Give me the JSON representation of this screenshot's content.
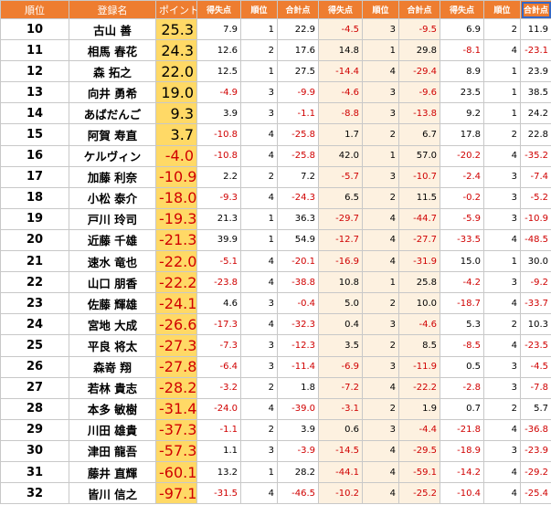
{
  "columns": [
    "順位",
    "登録名",
    "ポイント",
    "得失点",
    "順位",
    "合計点",
    "得失点",
    "順位",
    "合計点",
    "得失点",
    "順位",
    "合計点"
  ],
  "rows": [
    {
      "rank": "10",
      "name": "古山 善",
      "points": "25.3",
      "c": [
        "7.9",
        "1",
        "22.9",
        "-4.5",
        "3",
        "-9.5",
        "6.9",
        "2",
        "11.9"
      ]
    },
    {
      "rank": "11",
      "name": "相馬 春花",
      "points": "24.3",
      "c": [
        "12.6",
        "2",
        "17.6",
        "14.8",
        "1",
        "29.8",
        "-8.1",
        "4",
        "-23.1"
      ]
    },
    {
      "rank": "12",
      "name": "森 拓之",
      "points": "22.0",
      "c": [
        "12.5",
        "1",
        "27.5",
        "-14.4",
        "4",
        "-29.4",
        "8.9",
        "1",
        "23.9"
      ]
    },
    {
      "rank": "13",
      "name": "向井 勇希",
      "points": "19.0",
      "c": [
        "-4.9",
        "3",
        "-9.9",
        "-4.6",
        "3",
        "-9.6",
        "23.5",
        "1",
        "38.5"
      ]
    },
    {
      "rank": "14",
      "name": "あばだんご",
      "points": "9.3",
      "c": [
        "3.9",
        "3",
        "-1.1",
        "-8.8",
        "3",
        "-13.8",
        "9.2",
        "1",
        "24.2"
      ]
    },
    {
      "rank": "15",
      "name": "阿賀 寿直",
      "points": "3.7",
      "c": [
        "-10.8",
        "4",
        "-25.8",
        "1.7",
        "2",
        "6.7",
        "17.8",
        "2",
        "22.8"
      ]
    },
    {
      "rank": "16",
      "name": "ケルヴィン",
      "points": "-4.0",
      "c": [
        "-10.8",
        "4",
        "-25.8",
        "42.0",
        "1",
        "57.0",
        "-20.2",
        "4",
        "-35.2"
      ]
    },
    {
      "rank": "17",
      "name": "加藤 利奈",
      "points": "-10.9",
      "c": [
        "2.2",
        "2",
        "7.2",
        "-5.7",
        "3",
        "-10.7",
        "-2.4",
        "3",
        "-7.4"
      ]
    },
    {
      "rank": "18",
      "name": "小松 泰介",
      "points": "-18.0",
      "c": [
        "-9.3",
        "4",
        "-24.3",
        "6.5",
        "2",
        "11.5",
        "-0.2",
        "3",
        "-5.2"
      ]
    },
    {
      "rank": "19",
      "name": "戸川 玲司",
      "points": "-19.3",
      "c": [
        "21.3",
        "1",
        "36.3",
        "-29.7",
        "4",
        "-44.7",
        "-5.9",
        "3",
        "-10.9"
      ]
    },
    {
      "rank": "20",
      "name": "近藤 千雄",
      "points": "-21.3",
      "c": [
        "39.9",
        "1",
        "54.9",
        "-12.7",
        "4",
        "-27.7",
        "-33.5",
        "4",
        "-48.5"
      ]
    },
    {
      "rank": "21",
      "name": "速水 竜也",
      "points": "-22.0",
      "c": [
        "-5.1",
        "4",
        "-20.1",
        "-16.9",
        "4",
        "-31.9",
        "15.0",
        "1",
        "30.0"
      ]
    },
    {
      "rank": "22",
      "name": "山口 朋香",
      "points": "-22.2",
      "c": [
        "-23.8",
        "4",
        "-38.8",
        "10.8",
        "1",
        "25.8",
        "-4.2",
        "3",
        "-9.2"
      ]
    },
    {
      "rank": "23",
      "name": "佐藤 輝雄",
      "points": "-24.1",
      "c": [
        "4.6",
        "3",
        "-0.4",
        "5.0",
        "2",
        "10.0",
        "-18.7",
        "4",
        "-33.7"
      ]
    },
    {
      "rank": "24",
      "name": "宮地 大成",
      "points": "-26.6",
      "c": [
        "-17.3",
        "4",
        "-32.3",
        "0.4",
        "3",
        "-4.6",
        "5.3",
        "2",
        "10.3"
      ]
    },
    {
      "rank": "25",
      "name": "平良 将太",
      "points": "-27.3",
      "c": [
        "-7.3",
        "3",
        "-12.3",
        "3.5",
        "2",
        "8.5",
        "-8.5",
        "4",
        "-23.5"
      ]
    },
    {
      "rank": "26",
      "name": "森嵜 翔",
      "points": "-27.8",
      "c": [
        "-6.4",
        "3",
        "-11.4",
        "-6.9",
        "3",
        "-11.9",
        "0.5",
        "3",
        "-4.5"
      ]
    },
    {
      "rank": "27",
      "name": "若林 貴志",
      "points": "-28.2",
      "c": [
        "-3.2",
        "2",
        "1.8",
        "-7.2",
        "4",
        "-22.2",
        "-2.8",
        "3",
        "-7.8"
      ]
    },
    {
      "rank": "28",
      "name": "本多 敏樹",
      "points": "-31.4",
      "c": [
        "-24.0",
        "4",
        "-39.0",
        "-3.1",
        "2",
        "1.9",
        "0.7",
        "2",
        "5.7"
      ]
    },
    {
      "rank": "29",
      "name": "川田 雄貴",
      "points": "-37.3",
      "c": [
        "-1.1",
        "2",
        "3.9",
        "0.6",
        "3",
        "-4.4",
        "-21.8",
        "4",
        "-36.8"
      ]
    },
    {
      "rank": "30",
      "name": "津田 龍吾",
      "points": "-57.3",
      "c": [
        "1.1",
        "3",
        "-3.9",
        "-14.5",
        "4",
        "-29.5",
        "-18.9",
        "3",
        "-23.9"
      ]
    },
    {
      "rank": "31",
      "name": "藤井 直輝",
      "points": "-60.1",
      "c": [
        "13.2",
        "1",
        "28.2",
        "-44.1",
        "4",
        "-59.1",
        "-14.2",
        "4",
        "-29.2"
      ]
    },
    {
      "rank": "32",
      "name": "皆川 信之",
      "points": "-97.1",
      "c": [
        "-31.5",
        "4",
        "-46.5",
        "-10.2",
        "4",
        "-25.2",
        "-10.4",
        "4",
        "-25.4"
      ]
    }
  ]
}
